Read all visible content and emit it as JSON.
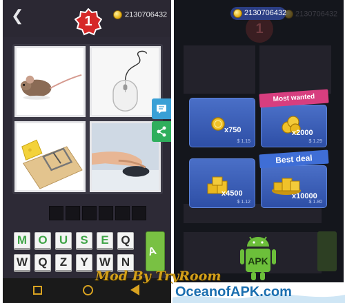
{
  "left_screen": {
    "level": "1",
    "coins": "2130706432",
    "answer_slots": 6,
    "keyboard": {
      "row1": [
        "M",
        "O",
        "U",
        "S",
        "E",
        "Q"
      ],
      "row2": [
        "W",
        "Q",
        "Z",
        "Y",
        "W",
        "N"
      ],
      "selected_row1": [
        true,
        true,
        true,
        true,
        true,
        false
      ]
    },
    "hint_label": "A"
  },
  "right_screen": {
    "coins": "2130706432",
    "ghost_coins": "2130706432",
    "ghost_level": "1",
    "offers": [
      {
        "amount": "x750",
        "price": "$ 1.15"
      },
      {
        "amount": "x2000",
        "price": "$ 1.29",
        "ribbon": "Most wanted"
      },
      {
        "amount": "x4500",
        "price": "$ 1.12"
      },
      {
        "amount": "x10000",
        "price": "$ 1.80",
        "ribbon": "Best deal"
      }
    ],
    "apk_label": "APK"
  },
  "watermarks": {
    "mod_text": "Mod By TryRoom",
    "site_text": "OceanofAPK.com"
  },
  "colors": {
    "accent_green": "#3fa447",
    "badge_red": "#d62828",
    "offer_blue": "#3b5fb8",
    "ribbon_pink": "#d73e7f",
    "ribbon_blue": "#3f6ed6",
    "nav_gold": "#d9a321"
  },
  "icons": [
    "back-arrow-icon",
    "coin-icon",
    "chat-icon",
    "share-icon",
    "hint-icon",
    "nav-square-icon",
    "nav-circle-icon",
    "nav-back-icon",
    "android-apk-icon"
  ]
}
